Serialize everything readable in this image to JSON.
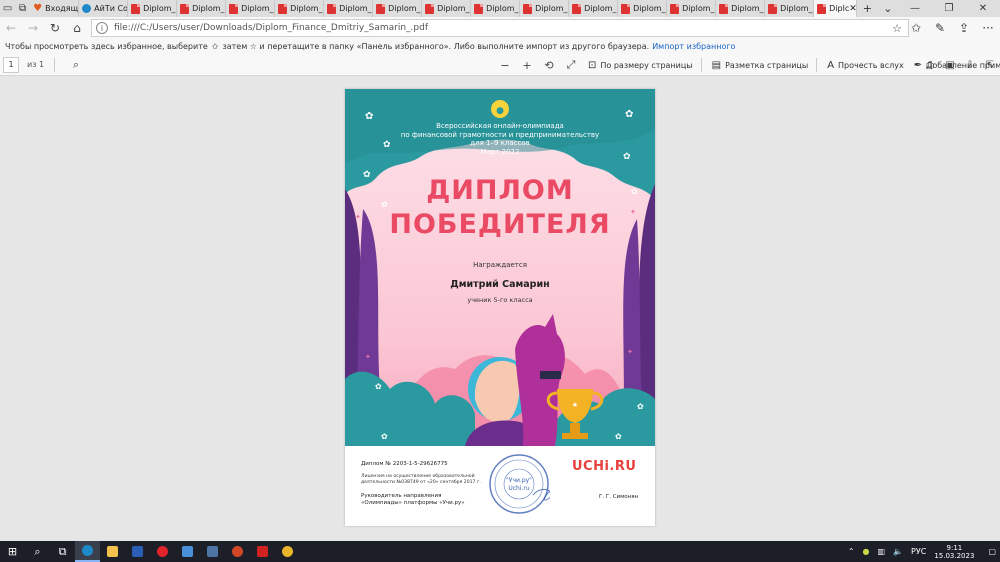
{
  "browser": {
    "tabs": [
      {
        "label": "Входящи",
        "icon": "heart"
      },
      {
        "label": "АйТи Coc",
        "icon": "brand"
      },
      {
        "label": "Diplom_F",
        "icon": "pdf"
      },
      {
        "label": "Diplom_I",
        "icon": "pdf"
      },
      {
        "label": "Diplom_I",
        "icon": "pdf"
      },
      {
        "label": "Diplom_I",
        "icon": "pdf"
      },
      {
        "label": "Diplom_I",
        "icon": "pdf"
      },
      {
        "label": "Diplom_I",
        "icon": "pdf"
      },
      {
        "label": "Diplom_I",
        "icon": "pdf"
      },
      {
        "label": "Diplom_I",
        "icon": "pdf"
      },
      {
        "label": "Diplom_I",
        "icon": "pdf"
      },
      {
        "label": "Diplom_I",
        "icon": "pdf"
      },
      {
        "label": "Diplom_I",
        "icon": "pdf"
      },
      {
        "label": "Diplom_I",
        "icon": "pdf"
      },
      {
        "label": "Diplom_I",
        "icon": "pdf"
      },
      {
        "label": "Diplom_I",
        "icon": "pdf"
      }
    ],
    "active_tab": {
      "label": "Diplc",
      "icon": "pdf"
    },
    "address": "file:///C:/Users/user/Downloads/Diplom_Finance_Dmitriy_Samarin_.pdf",
    "favorites_hint": "Чтобы просмотреть здесь избранное, выберите",
    "favorites_hint_2": "затем ☆ и перетащите в папку «Панель избранного». Либо выполните импорт из другого браузера.",
    "favorites_link": "Импорт избранного"
  },
  "pdf_toolbar": {
    "page_current": "1",
    "page_total": "из 1",
    "fit_page": "По размеру страницы",
    "page_layout": "Разметка страницы",
    "read_aloud": "Прочесть вслух",
    "add_notes": "Добавление примечаний"
  },
  "diploma": {
    "header_lines": [
      "Всероссийская онлайн-олимпиада",
      "по финансовой грамотности и предпринимательству",
      "для 1–9 классов",
      "Март 2022"
    ],
    "title_line1": "ДИПЛОМ",
    "title_line2": "ПОБЕДИТЕЛЯ",
    "awarded": "Награждается",
    "name": "Дмитрий Самарин",
    "grade": "ученик 5-го класса",
    "number": "Диплом № 2203-1-5-29626775",
    "license": "Лицензия на осуществление образовательной деятельности №038749 от «20» сентября 2017 г.",
    "head_role": "Руководитель направления «Олимпиады» платформы «Учи.ру»",
    "signer": "Г. Г. Симонян",
    "logo": "UCHi.RU",
    "stamp_top": "\"Учи.ру\"",
    "stamp_bottom": "Uchi.ru"
  },
  "taskbar": {
    "lang": "РУС",
    "time": "9:11",
    "date": "15.03.2023"
  },
  "colors": {
    "teal": "#2b9aa0",
    "pink_title": "#ea4a63",
    "purple": "#5b2d7e",
    "logo_red": "#e8413b"
  }
}
